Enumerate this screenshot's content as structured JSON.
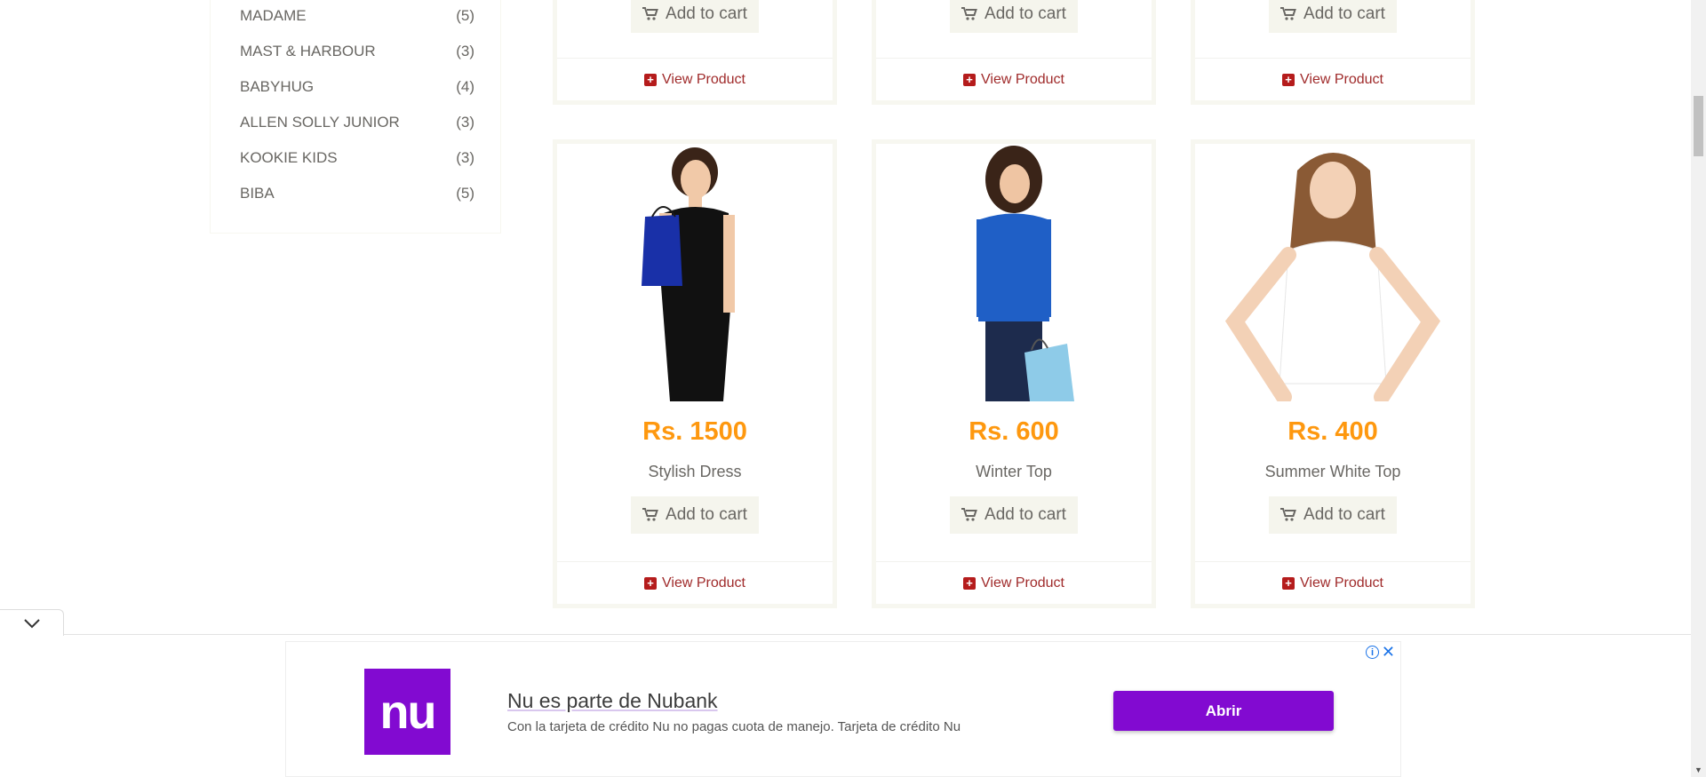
{
  "brands": [
    {
      "name": "MADAME",
      "count": "(5)"
    },
    {
      "name": "MAST & HARBOUR",
      "count": "(3)"
    },
    {
      "name": "BABYHUG",
      "count": "(4)"
    },
    {
      "name": "ALLEN SOLLY JUNIOR",
      "count": "(3)"
    },
    {
      "name": "KOOKIE KIDS",
      "count": "(3)"
    },
    {
      "name": "BIBA",
      "count": "(5)"
    }
  ],
  "top_row": [
    {
      "add_to_cart": "Add to cart",
      "view_product": "View Product"
    },
    {
      "add_to_cart": "Add to cart",
      "view_product": "View Product"
    },
    {
      "add_to_cart": "Add to cart",
      "view_product": "View Product"
    }
  ],
  "products": [
    {
      "price": "Rs. 1500",
      "name": "Stylish Dress",
      "add_to_cart": "Add to cart",
      "view_product": "View Product",
      "image": "woman-black-dress-blue-bag"
    },
    {
      "price": "Rs. 600",
      "name": "Winter Top",
      "add_to_cart": "Add to cart",
      "view_product": "View Product",
      "image": "woman-blue-sweater-shopping-bag"
    },
    {
      "price": "Rs. 400",
      "name": "Summer White Top",
      "add_to_cart": "Add to cart",
      "view_product": "View Product",
      "image": "girl-white-tshirt"
    }
  ],
  "ad": {
    "logo": "nu",
    "title": "Nu es parte de Nubank",
    "description": "Con la tarjeta de crédito Nu no pagas cuota de manejo. Tarjeta de crédito Nu",
    "cta": "Abrir",
    "brand_color": "#820AD1"
  },
  "colors": {
    "price": "#FE980F",
    "view_product": "#a02b2b",
    "button_bg": "#F5F5ED"
  }
}
